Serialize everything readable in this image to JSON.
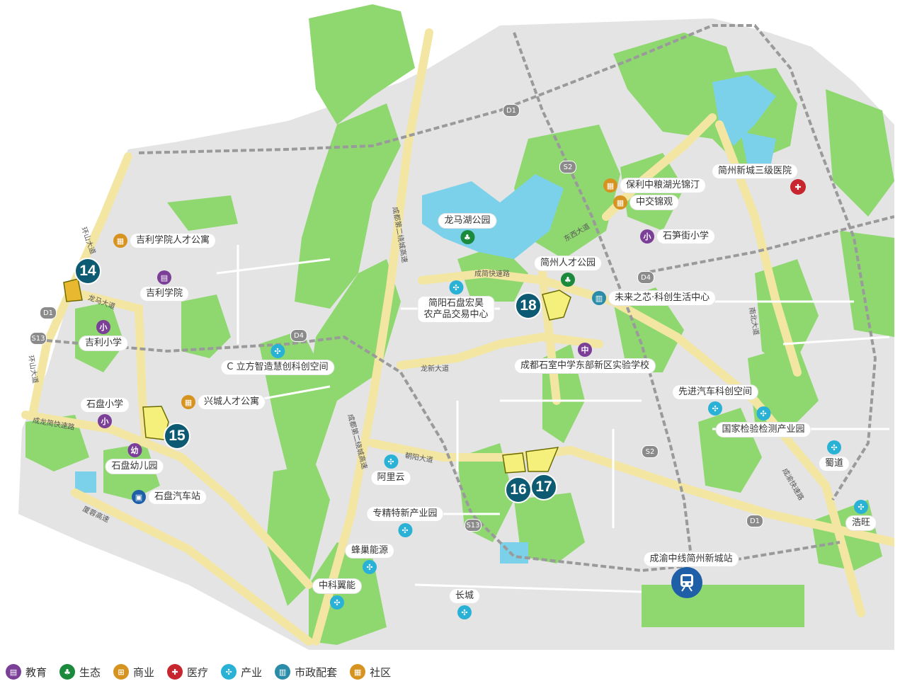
{
  "colors": {
    "background": "#e7e7e7",
    "green": "#8fd870",
    "water": "#7cd1ea",
    "expressway": "#f3e6a3",
    "railway": "#9a9a9a",
    "plot": "#f5f07c",
    "marker": "#0d5b73"
  },
  "legend": [
    {
      "name": "education",
      "label": "教育",
      "cls": "edu",
      "glyph": "▤"
    },
    {
      "name": "ecology",
      "label": "生态",
      "cls": "eco",
      "glyph": "♣"
    },
    {
      "name": "commerce",
      "label": "商业",
      "cls": "com",
      "glyph": "⊞"
    },
    {
      "name": "medical",
      "label": "医疗",
      "cls": "med",
      "glyph": "✚"
    },
    {
      "name": "industry",
      "label": "产业",
      "cls": "ind",
      "glyph": "✣"
    },
    {
      "name": "civic",
      "label": "市政配套",
      "cls": "civ",
      "glyph": "▥"
    },
    {
      "name": "community",
      "label": "社区",
      "cls": "cmt",
      "glyph": "▦"
    }
  ],
  "pois": {
    "jili_talent_apartment": "吉利学院人才公寓",
    "jili_college": "吉利学院",
    "jili_primary": "吉利小学",
    "c_cube_space": "C 立方智造慧创科创空间",
    "xingcheng_apartment": "兴城人才公寓",
    "shipan_primary": "石盘小学",
    "shipan_kindergarten": "石盘幼儿园",
    "shipan_bus_station": "石盘汽车站",
    "longma_lake_park": "龙马湖公园",
    "jianyang_market": "简阳石盘宏昊\n农产品交易中心",
    "jianzhou_talent_park": "简州人才公园",
    "future_core_center": "未来之芯·科创生活中心",
    "chengdu_shishi_school": "成都石室中学东部新区实验学校",
    "baoli_apartment": "保利中粮湖光锦汀",
    "zhongjiao_jinguan": "中交锦观",
    "shisunjie_primary": "石笋街小学",
    "jianzhou_hospital": "简州新城三级医院",
    "advanced_auto_space": "先进汽车科创空间",
    "national_testing_park": "国家检验检测产业园",
    "shudao": "蜀道",
    "haowang": "浩旺",
    "aliyun": "阿里云",
    "specialized_park": "专精特新产业园",
    "fengchao_energy": "蜂巢能源",
    "zhongke_yineng": "中科翼能",
    "changcheng": "长城",
    "chengyu_station": "成渝中线简州新城站",
    "edu_glyph_small": "小",
    "edu_glyph_mid": "中",
    "edu_glyph_kg": "幼"
  },
  "plots": [
    "14",
    "15",
    "16",
    "17",
    "18"
  ],
  "roads": {
    "huanshan": "环山大道",
    "longma": "龙马大道",
    "chengdu_ring2": "成都第二绕城高速",
    "chengjian_expressway": "成简快速路",
    "longxin": "龙新大道",
    "chaoyang": "朝阳大道",
    "dongxi": "东西大道",
    "nanbei": "南北大道",
    "chengyu_expressway": "成渝快速路",
    "chenglong_expressway": "成龙简快速路",
    "xiarong": "厦蓉高速"
  },
  "shields": {
    "d1": "D1",
    "d4": "D4",
    "s2": "S2",
    "s13": "S13"
  }
}
